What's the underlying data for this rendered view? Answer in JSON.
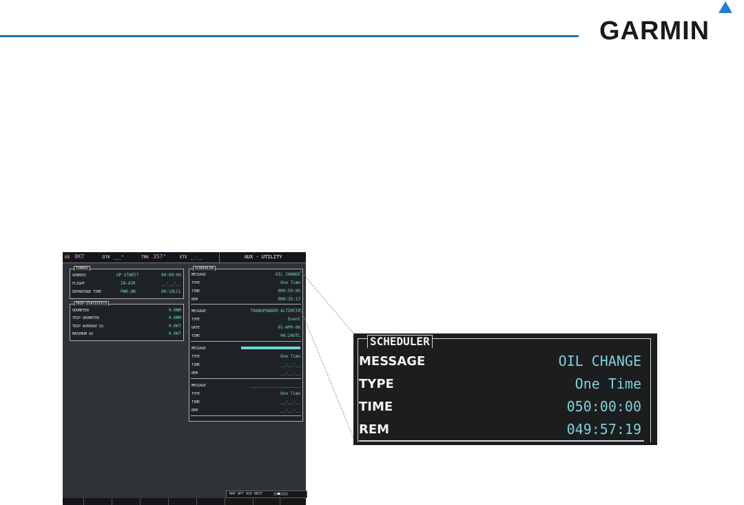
{
  "brand": {
    "logo_text": "GARMIN",
    "colors": {
      "rule": "#1f6fb5",
      "triangle": "#1f7fd2"
    }
  },
  "mfd": {
    "topbar": {
      "gs_label": "GS",
      "gs_value": "0KT",
      "dtk_label": "DTK",
      "dtk_value": "___°",
      "trk_label": "TRK",
      "trk_value": "357°",
      "ete_label": "ETE",
      "ete_value": "__:__",
      "page_title": "AUX - UTILITY"
    },
    "timers": {
      "title": "TIMERS",
      "rows": [
        {
          "label": "GENERIC",
          "mid": "UP   START?",
          "value": "00:00:00"
        },
        {
          "label": "FLIGHT",
          "mid": "IN-AIR",
          "value": "__:__:__"
        },
        {
          "label": "DEPARTURE TIME",
          "mid": "PWR-ON",
          "value": "00:10LCL"
        }
      ]
    },
    "trip_statistics": {
      "title": "TRIP STATISTICS",
      "rows": [
        {
          "label": "ODOMETER",
          "value": "0.0NM"
        },
        {
          "label": "TRIP ODOMETER",
          "value": "0.0NM"
        },
        {
          "label": "TRIP AVERAGE GS",
          "value": "0.0KT"
        },
        {
          "label": "MAXIMUM GS",
          "value": "0.0KT"
        }
      ]
    },
    "scheduler": {
      "title": "SCHEDULER",
      "groups": [
        {
          "rows": [
            {
              "label": "MESSAGE",
              "value": "OIL CHANGE"
            },
            {
              "label": "TYPE",
              "value": "One Time"
            },
            {
              "label": "TIME",
              "value": "000:50:00"
            },
            {
              "label": "REM",
              "value": "000:35:17"
            }
          ]
        },
        {
          "rows": [
            {
              "label": "MESSAGE",
              "value": "TRANSPONDER ALTIMITR"
            },
            {
              "label": "TYPE",
              "value": "Event"
            },
            {
              "label": "DATE",
              "value": "01-APR-08"
            },
            {
              "label": "TIME",
              "value": "00:20UTL"
            }
          ]
        },
        {
          "rows": [
            {
              "label": "MESSAGE",
              "value": ""
            },
            {
              "label": "TYPE",
              "value": "One Time"
            },
            {
              "label": "TIME",
              "value": "__:__:__"
            },
            {
              "label": "REM",
              "value": "__:__:__"
            }
          ]
        },
        {
          "rows": [
            {
              "label": "MESSAGE",
              "value": "____________________"
            },
            {
              "label": "TYPE",
              "value": "One Time"
            },
            {
              "label": "TIME",
              "value": "__:__:__"
            },
            {
              "label": "REM",
              "value": "__:__:__"
            }
          ]
        }
      ]
    },
    "page_group": {
      "text": "MAP WPT AUX NRST"
    }
  },
  "zoom": {
    "title": "SCHEDULER",
    "rows": [
      {
        "label": "MESSAGE",
        "value": "OIL CHANGE"
      },
      {
        "label": "TYPE",
        "value": "One Time"
      },
      {
        "label": "TIME",
        "value": "050:00:00"
      },
      {
        "label": "REM",
        "value": "049:57:19"
      }
    ]
  }
}
